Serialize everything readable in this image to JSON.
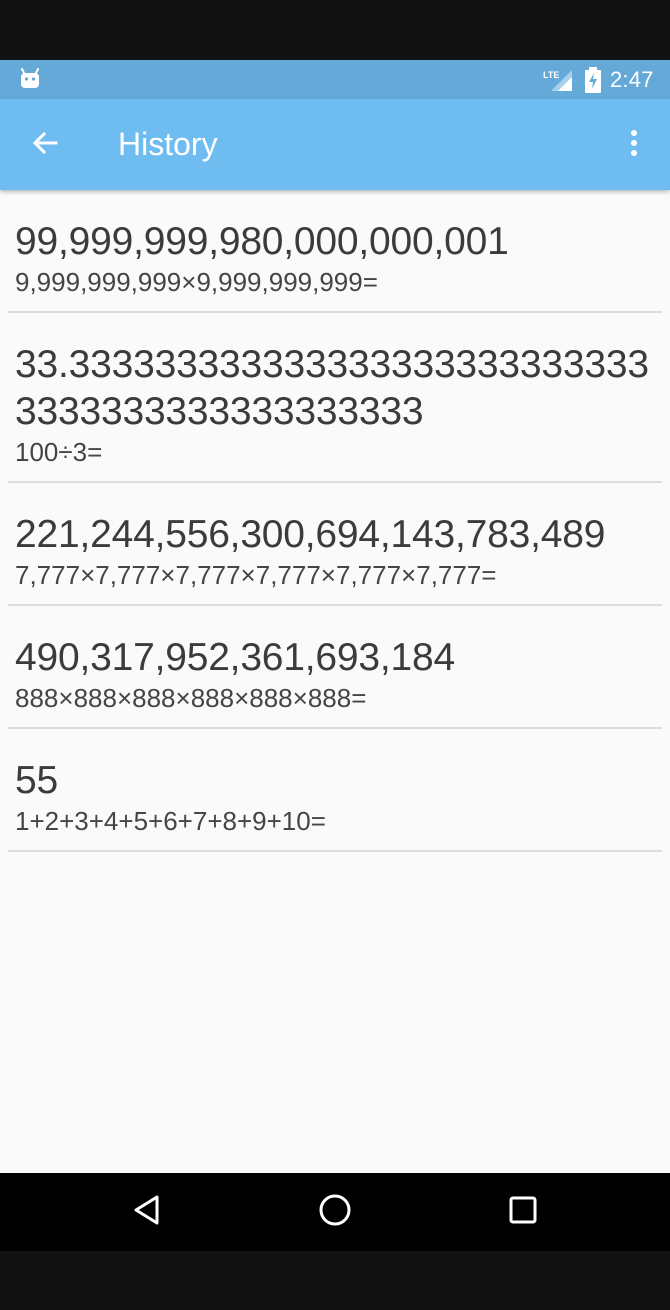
{
  "status_bar": {
    "time": "2:47",
    "network": "LTE",
    "icons": [
      "android-notification-icon",
      "lte-signal-icon",
      "battery-charging-icon"
    ]
  },
  "app_bar": {
    "title": "History",
    "back_icon": "arrow-back-icon",
    "menu_icon": "more-vert-icon"
  },
  "history": [
    {
      "result": "99,999,999,980,000,000,001",
      "expression": "9,999,999,999×9,999,999,999="
    },
    {
      "result": "33.3333333333333333333333333333333333333333333333",
      "expression": "100÷3="
    },
    {
      "result": "221,244,556,300,694,143,783,489",
      "expression": "7,777×7,777×7,777×7,777×7,777×7,777="
    },
    {
      "result": "490,317,952,361,693,184",
      "expression": "888×888×888×888×888×888="
    },
    {
      "result": "55",
      "expression": "1+2+3+4+5+6+7+8+9+10="
    }
  ],
  "nav_bar": {
    "icons": [
      "back-triangle-icon",
      "home-circle-icon",
      "recents-square-icon"
    ]
  },
  "colors": {
    "status_bar": "#64a9d8",
    "app_bar": "#6fbcf0",
    "background": "#fafafa",
    "text": "#3b3b3b"
  }
}
